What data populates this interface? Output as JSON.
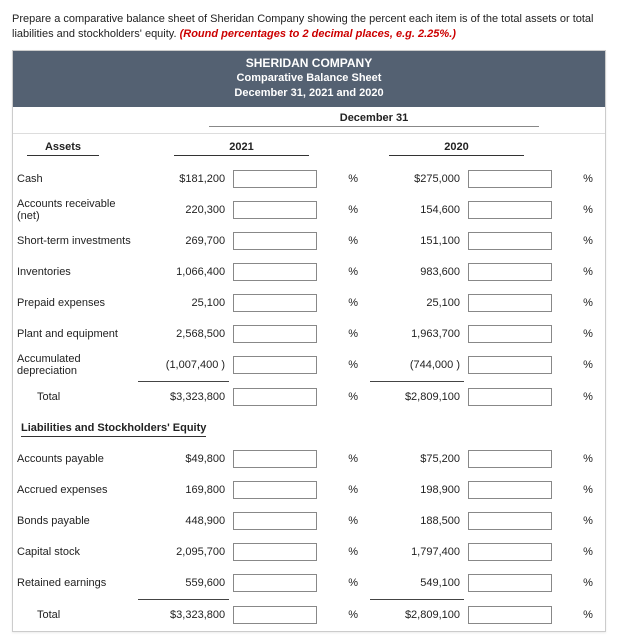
{
  "intro": {
    "text": "Prepare a comparative balance sheet of Sheridan Company showing the percent each item is of the total assets or total liabilities and stockholders' equity. ",
    "red": "(Round percentages to 2 decimal places, e.g. 2.25%.)"
  },
  "header": {
    "company": "SHERIDAN COMPANY",
    "title": "Comparative Balance Sheet",
    "date": "December 31, 2021 and 2020"
  },
  "colhead": "December 31",
  "assets_h": "Assets",
  "years": {
    "y1": "2021",
    "y2": "2020"
  },
  "pct_symbol": "%",
  "assets": [
    {
      "label": "Cash",
      "v1": "$181,200",
      "v2": "$275,000",
      "indent": false
    },
    {
      "label": "Accounts receivable (net)",
      "v1": "220,300",
      "v2": "154,600",
      "indent": false
    },
    {
      "label": "Short-term investments",
      "v1": "269,700",
      "v2": "151,100",
      "indent": false
    },
    {
      "label": "Inventories",
      "v1": "1,066,400",
      "v2": "983,600",
      "indent": false
    },
    {
      "label": "Prepaid expenses",
      "v1": "25,100",
      "v2": "25,100",
      "indent": false
    },
    {
      "label": "Plant and equipment",
      "v1": "2,568,500",
      "v2": "1,963,700",
      "indent": false
    },
    {
      "label": "Accumulated depreciation",
      "v1": "(1,007,400 )",
      "v2": "(744,000 )",
      "indent": false
    },
    {
      "label": "Total",
      "v1": "$3,323,800",
      "v2": "$2,809,100",
      "indent": true,
      "total": true
    }
  ],
  "liab_h": "Liabilities and Stockholders' Equity",
  "liabilities": [
    {
      "label": "Accounts payable",
      "v1": "$49,800",
      "v2": "$75,200",
      "indent": false
    },
    {
      "label": "Accrued expenses",
      "v1": "169,800",
      "v2": "198,900",
      "indent": false
    },
    {
      "label": "Bonds payable",
      "v1": "448,900",
      "v2": "188,500",
      "indent": false
    },
    {
      "label": "Capital stock",
      "v1": "2,095,700",
      "v2": "1,797,400",
      "indent": false
    },
    {
      "label": "Retained earnings",
      "v1": "559,600",
      "v2": "549,100",
      "indent": false
    },
    {
      "label": "Total",
      "v1": "$3,323,800",
      "v2": "$2,809,100",
      "indent": true,
      "total": true
    }
  ]
}
